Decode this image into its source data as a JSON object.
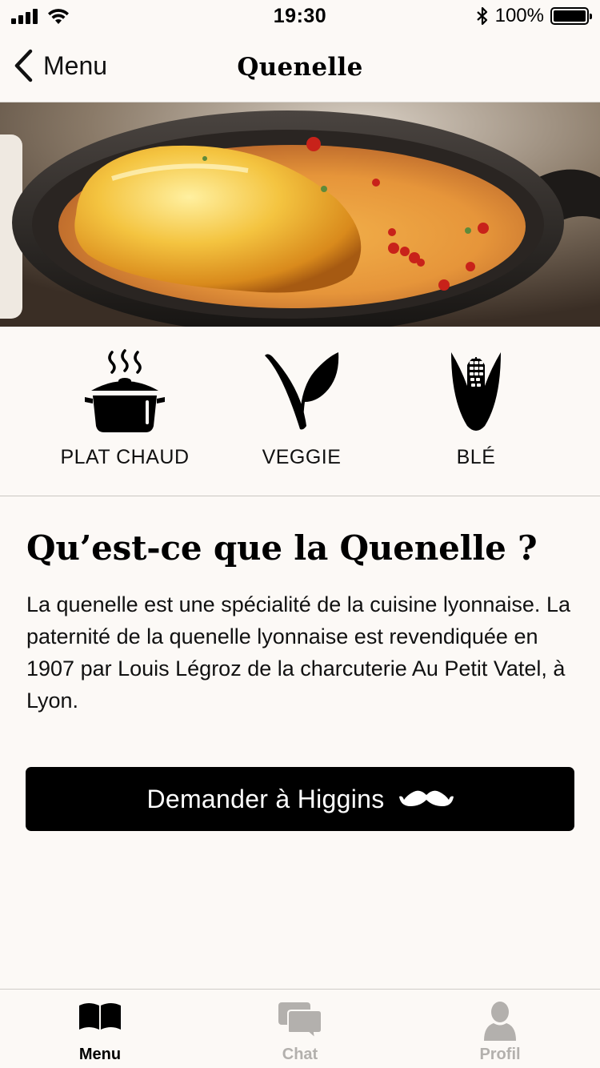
{
  "status_bar": {
    "time": "19:30",
    "battery_text": "100%",
    "icons": [
      "signal-icon",
      "wifi-icon",
      "bluetooth-icon",
      "battery-icon"
    ]
  },
  "nav": {
    "back_label": "Menu",
    "title": "Quenelle"
  },
  "tags": [
    {
      "label": "PLAT CHAUD",
      "icon": "cooking-pot-icon"
    },
    {
      "label": "VEGGIE",
      "icon": "leaf-v-icon"
    },
    {
      "label": "BLÉ",
      "icon": "corn-icon"
    }
  ],
  "description": {
    "heading": "Qu’est-ce que la Quenelle ?",
    "body": "La quenelle est une spécialité de la cuisine lyonnaise. La paternité de la quenelle lyonnaise est revendiquée en 1907 par Louis Légroz de la charcuterie Au Petit Vatel, à Lyon."
  },
  "cta": {
    "label": "Demander à Higgins",
    "icon": "mustache-icon"
  },
  "tab_bar": {
    "items": [
      {
        "label": "Menu",
        "icon": "book-icon",
        "active": true
      },
      {
        "label": "Chat",
        "icon": "chat-bubbles-icon",
        "active": false
      },
      {
        "label": "Profil",
        "icon": "person-icon",
        "active": false
      }
    ]
  },
  "colors": {
    "background": "#fcf9f6",
    "text": "#000000",
    "inactive_tab": "#b3b0ad",
    "cta_background": "#000000",
    "cta_text": "#ffffff"
  }
}
